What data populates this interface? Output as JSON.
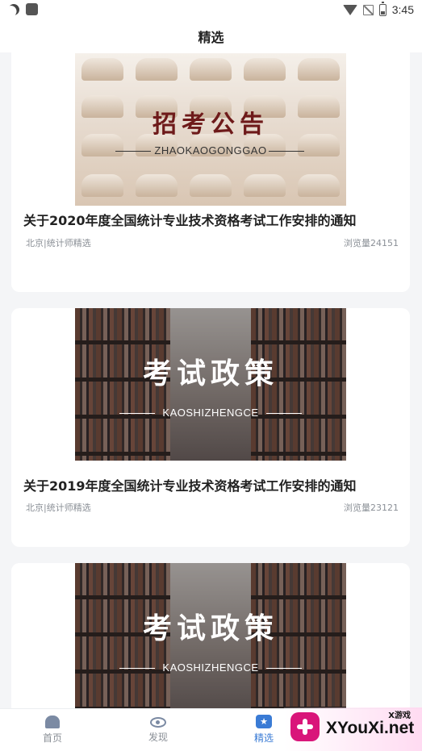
{
  "status_bar": {
    "time": "3:45",
    "icons": [
      "moon-icon",
      "notification-square-icon",
      "wifi-icon",
      "no-signal-icon",
      "battery-icon"
    ]
  },
  "header": {
    "title": "精选"
  },
  "articles": [
    {
      "image": {
        "title": "招考公告",
        "subtitle": "ZHAOKAOGONGGAO",
        "theme": "lecture-hall-seats"
      },
      "title": "关于2020年度全国统计专业技术资格考试工作安排的通知",
      "source": "北京|统计师精选",
      "views": "浏览量24151"
    },
    {
      "image": {
        "title": "考试政策",
        "subtitle": "KAOSHIZHENGCE",
        "theme": "library-bookshelves"
      },
      "title": "关于2019年度全国统计专业技术资格考试工作安排的通知",
      "source": "北京|统计师精选",
      "views": "浏览量23121"
    },
    {
      "image": {
        "title": "考试政策",
        "subtitle": "KAOSHIZHENGCE",
        "theme": "library-bookshelves"
      }
    }
  ],
  "bottom_nav": {
    "items": [
      {
        "label": "首页",
        "icon": "home-icon"
      },
      {
        "label": "发现",
        "icon": "eye-icon"
      },
      {
        "label": "精选",
        "icon": "featured-star-icon",
        "active": true
      }
    ],
    "active_color": "#3a7bd5",
    "inactive_color": "#8a8f96"
  },
  "watermark": {
    "small_text": "X游戏",
    "site": "XYouXi.net"
  }
}
